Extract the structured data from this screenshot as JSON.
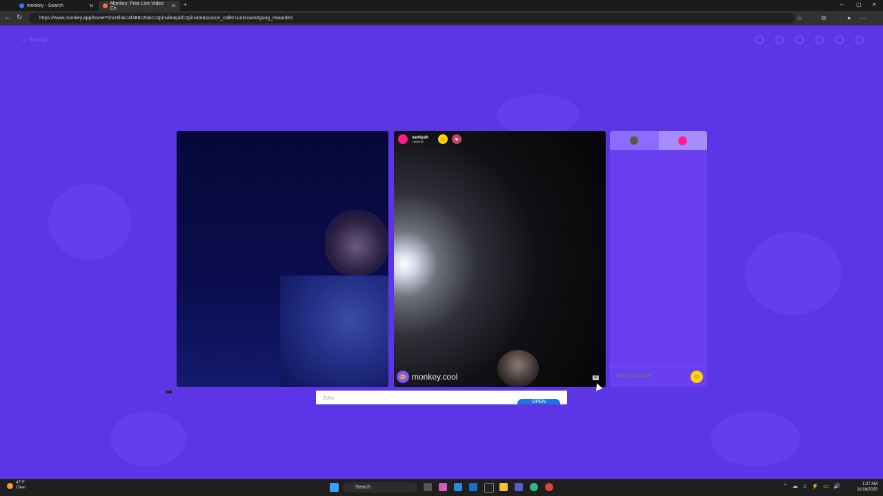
{
  "browser": {
    "tabs": [
      {
        "title": "monkey - Search",
        "active": false
      },
      {
        "title": "Monkey: Free Live Video Ch",
        "active": true
      }
    ],
    "new_tab": "+",
    "url": "https://www.monkey.app/home?shortlink=4f488c2b&c=2pinvite&pid=2pinvite&source_caller=unknown#goog_rewarded",
    "window_controls": {
      "minimize": "–",
      "maximize": "▢",
      "close": "✕"
    }
  },
  "page": {
    "get_app": "Get App",
    "top_icons": [
      "home-icon",
      "search-icon",
      "profile-icon",
      "history-icon",
      "message-icon",
      "avatar-icon"
    ],
    "remote_user": {
      "name": "samiyah",
      "location": "California"
    },
    "watermark": "monkey.cool",
    "chat": {
      "input_placeholder": "Send Message"
    },
    "ad": {
      "label": "Zoho",
      "button": "OPEN"
    }
  },
  "taskbar": {
    "weather": {
      "temp": "47°F",
      "condition": "Clear"
    },
    "search_label": "Search",
    "time": "1:27 AM",
    "date": "11/16/2025"
  },
  "colors": {
    "page_bg": "#5b35e6",
    "chat_bg": "#6a3ff0",
    "accent_pink": "#ff1e8a",
    "send_yellow": "#ffd400"
  }
}
